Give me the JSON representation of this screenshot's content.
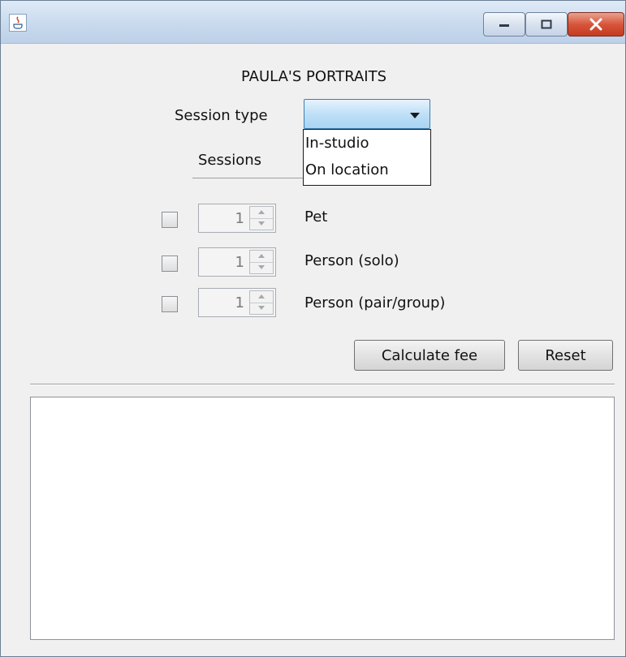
{
  "window": {
    "icon": "java-icon",
    "buttons": [
      "minimize-icon",
      "maximize-icon",
      "close-icon"
    ]
  },
  "app_title": "PAULA'S PORTRAITS",
  "session_type": {
    "label": "Session type",
    "selected": "",
    "options": [
      "In-studio",
      "On location"
    ]
  },
  "sessions": {
    "label": "Sessions",
    "rows": [
      {
        "label": "Pet",
        "checked": false,
        "count": "1"
      },
      {
        "label": "Person (solo)",
        "checked": false,
        "count": "1"
      },
      {
        "label": "Person (pair/group)",
        "checked": false,
        "count": "1"
      }
    ]
  },
  "actions": {
    "calculate": "Calculate fee",
    "reset": "Reset"
  },
  "output": {
    "text": ""
  },
  "colors": {
    "combo_highlight": "#bfe0f7",
    "close_button": "#d7553b"
  }
}
